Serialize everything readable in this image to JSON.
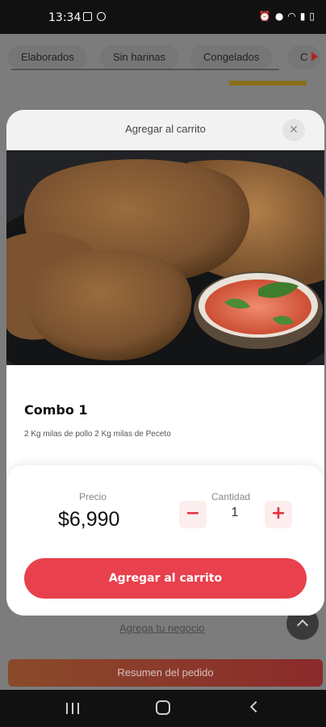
{
  "status_bar": {
    "time": "13:34"
  },
  "categories": {
    "chips": [
      {
        "label": "Elaborados"
      },
      {
        "label": "Sin harinas"
      },
      {
        "label": "Congelados"
      },
      {
        "label": "C"
      }
    ]
  },
  "background_page": {
    "link_text": "Agrega tu negocio",
    "summary_button": "Resumen del pedido"
  },
  "modal": {
    "title": "Agregar al carrito",
    "close_icon": "close-icon",
    "product": {
      "name": "Combo 1",
      "description": "2 Kg milas de pollo 2 Kg milas de Peceto"
    },
    "price_label": "Precio",
    "price": "$6,990",
    "quantity_label": "Cantidad",
    "quantity": "1",
    "minus_label": "−",
    "plus_label": "+",
    "add_button": "Agregar al carrito"
  },
  "colors": {
    "accent": "#e9404d",
    "accent_soft": "#fdeeee",
    "overlay": "#7c7c7c"
  }
}
